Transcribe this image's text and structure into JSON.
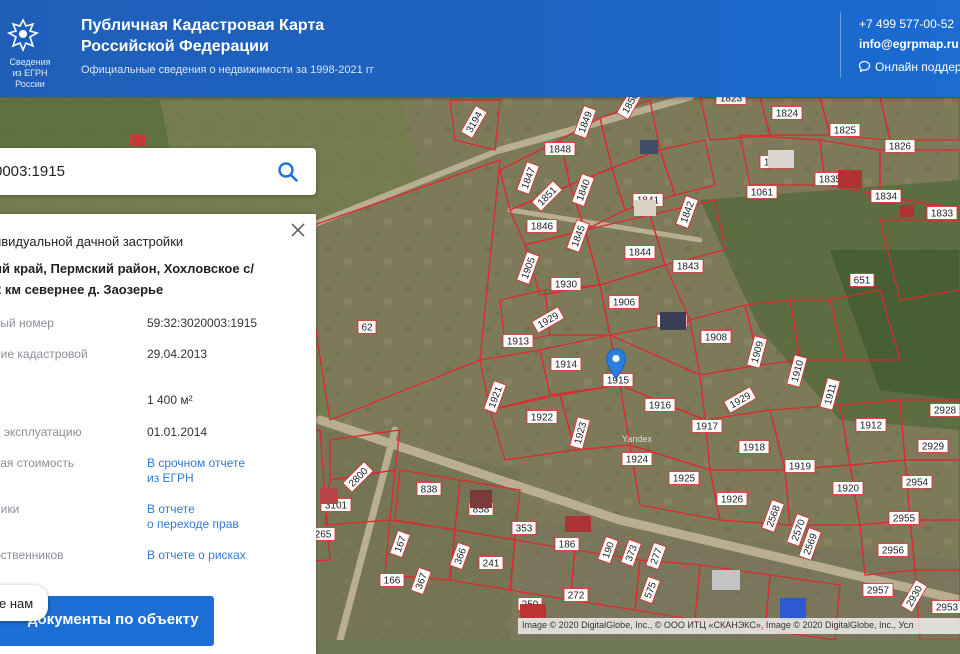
{
  "header": {
    "logo_text": "Сведения\nиз ЕГРН России",
    "title": "Публичная Кадастровая Карта Российской Федерации",
    "subtitle": "Официальные сведения о недвижимости за 1998-2021 гг",
    "phone": "+7 499 577-00-52",
    "email": "info@egrpmap.ru",
    "support": "Онлайн поддер"
  },
  "search": {
    "value": "0003:1915",
    "icon": "search-icon"
  },
  "panel": {
    "type": "ивидуальной дачной застройки",
    "address": "ий край, Пермский район, Хохловское с/\n2 км севернее д. Заозерье",
    "rows": [
      {
        "label": "вый номер",
        "value": "59:32:3020003:1915"
      },
      {
        "label": "ние кадастровой\nи",
        "value": "29.04.2013"
      },
      {
        "label": "",
        "value": "1 400 м²"
      },
      {
        "label": "в эксплуатацию",
        "value": "01.01.2014"
      },
      {
        "label": "вая стоимость",
        "link": "В срочном отчете\nиз ЕГРН"
      },
      {
        "label": "ники",
        "link": "В отчете\nо переходе прав"
      },
      {
        "label": "бственников",
        "link": "В отчете о рисках"
      }
    ],
    "cta_button": "документы по объекту",
    "chat_bubble": "е нам"
  },
  "map": {
    "watermark": "Yandex",
    "attribution": "Image © 2020 DigitalGlobe, Inc., © ООО ИТЦ «СКАНЭКС», Image © 2020 DigitalGlobe, Inc., Усл",
    "parcel_labels": [
      "3194",
      "1850",
      "1849",
      "1848",
      "1847",
      "1851",
      "1840",
      "1846",
      "1845",
      "1841",
      "1842",
      "1844",
      "1843",
      "1905",
      "1930",
      "1906",
      "1929",
      "1913",
      "1914",
      "1907",
      "1908",
      "1915",
      "1921",
      "1922",
      "1923",
      "1916",
      "1917",
      "1918",
      "1924",
      "1919",
      "1925",
      "1920",
      "1926",
      "1912",
      "1911",
      "1910",
      "1909",
      "1929",
      "1823",
      "1824",
      "1825",
      "1826",
      "1836",
      "1835",
      "1834",
      "1833",
      "1061",
      "651",
      "2928",
      "2929",
      "2954",
      "2955",
      "2956",
      "2957",
      "2930",
      "2953",
      "62",
      "2800",
      "3101",
      "265",
      "838",
      "858",
      "353",
      "186",
      "366",
      "241",
      "259",
      "272",
      "277",
      "190",
      "167",
      "166",
      "367",
      "2570",
      "2569",
      "2568",
      "373",
      "575"
    ],
    "colors": {
      "parcel_border": "#e0282e",
      "label_bg": "#ffffff"
    }
  }
}
